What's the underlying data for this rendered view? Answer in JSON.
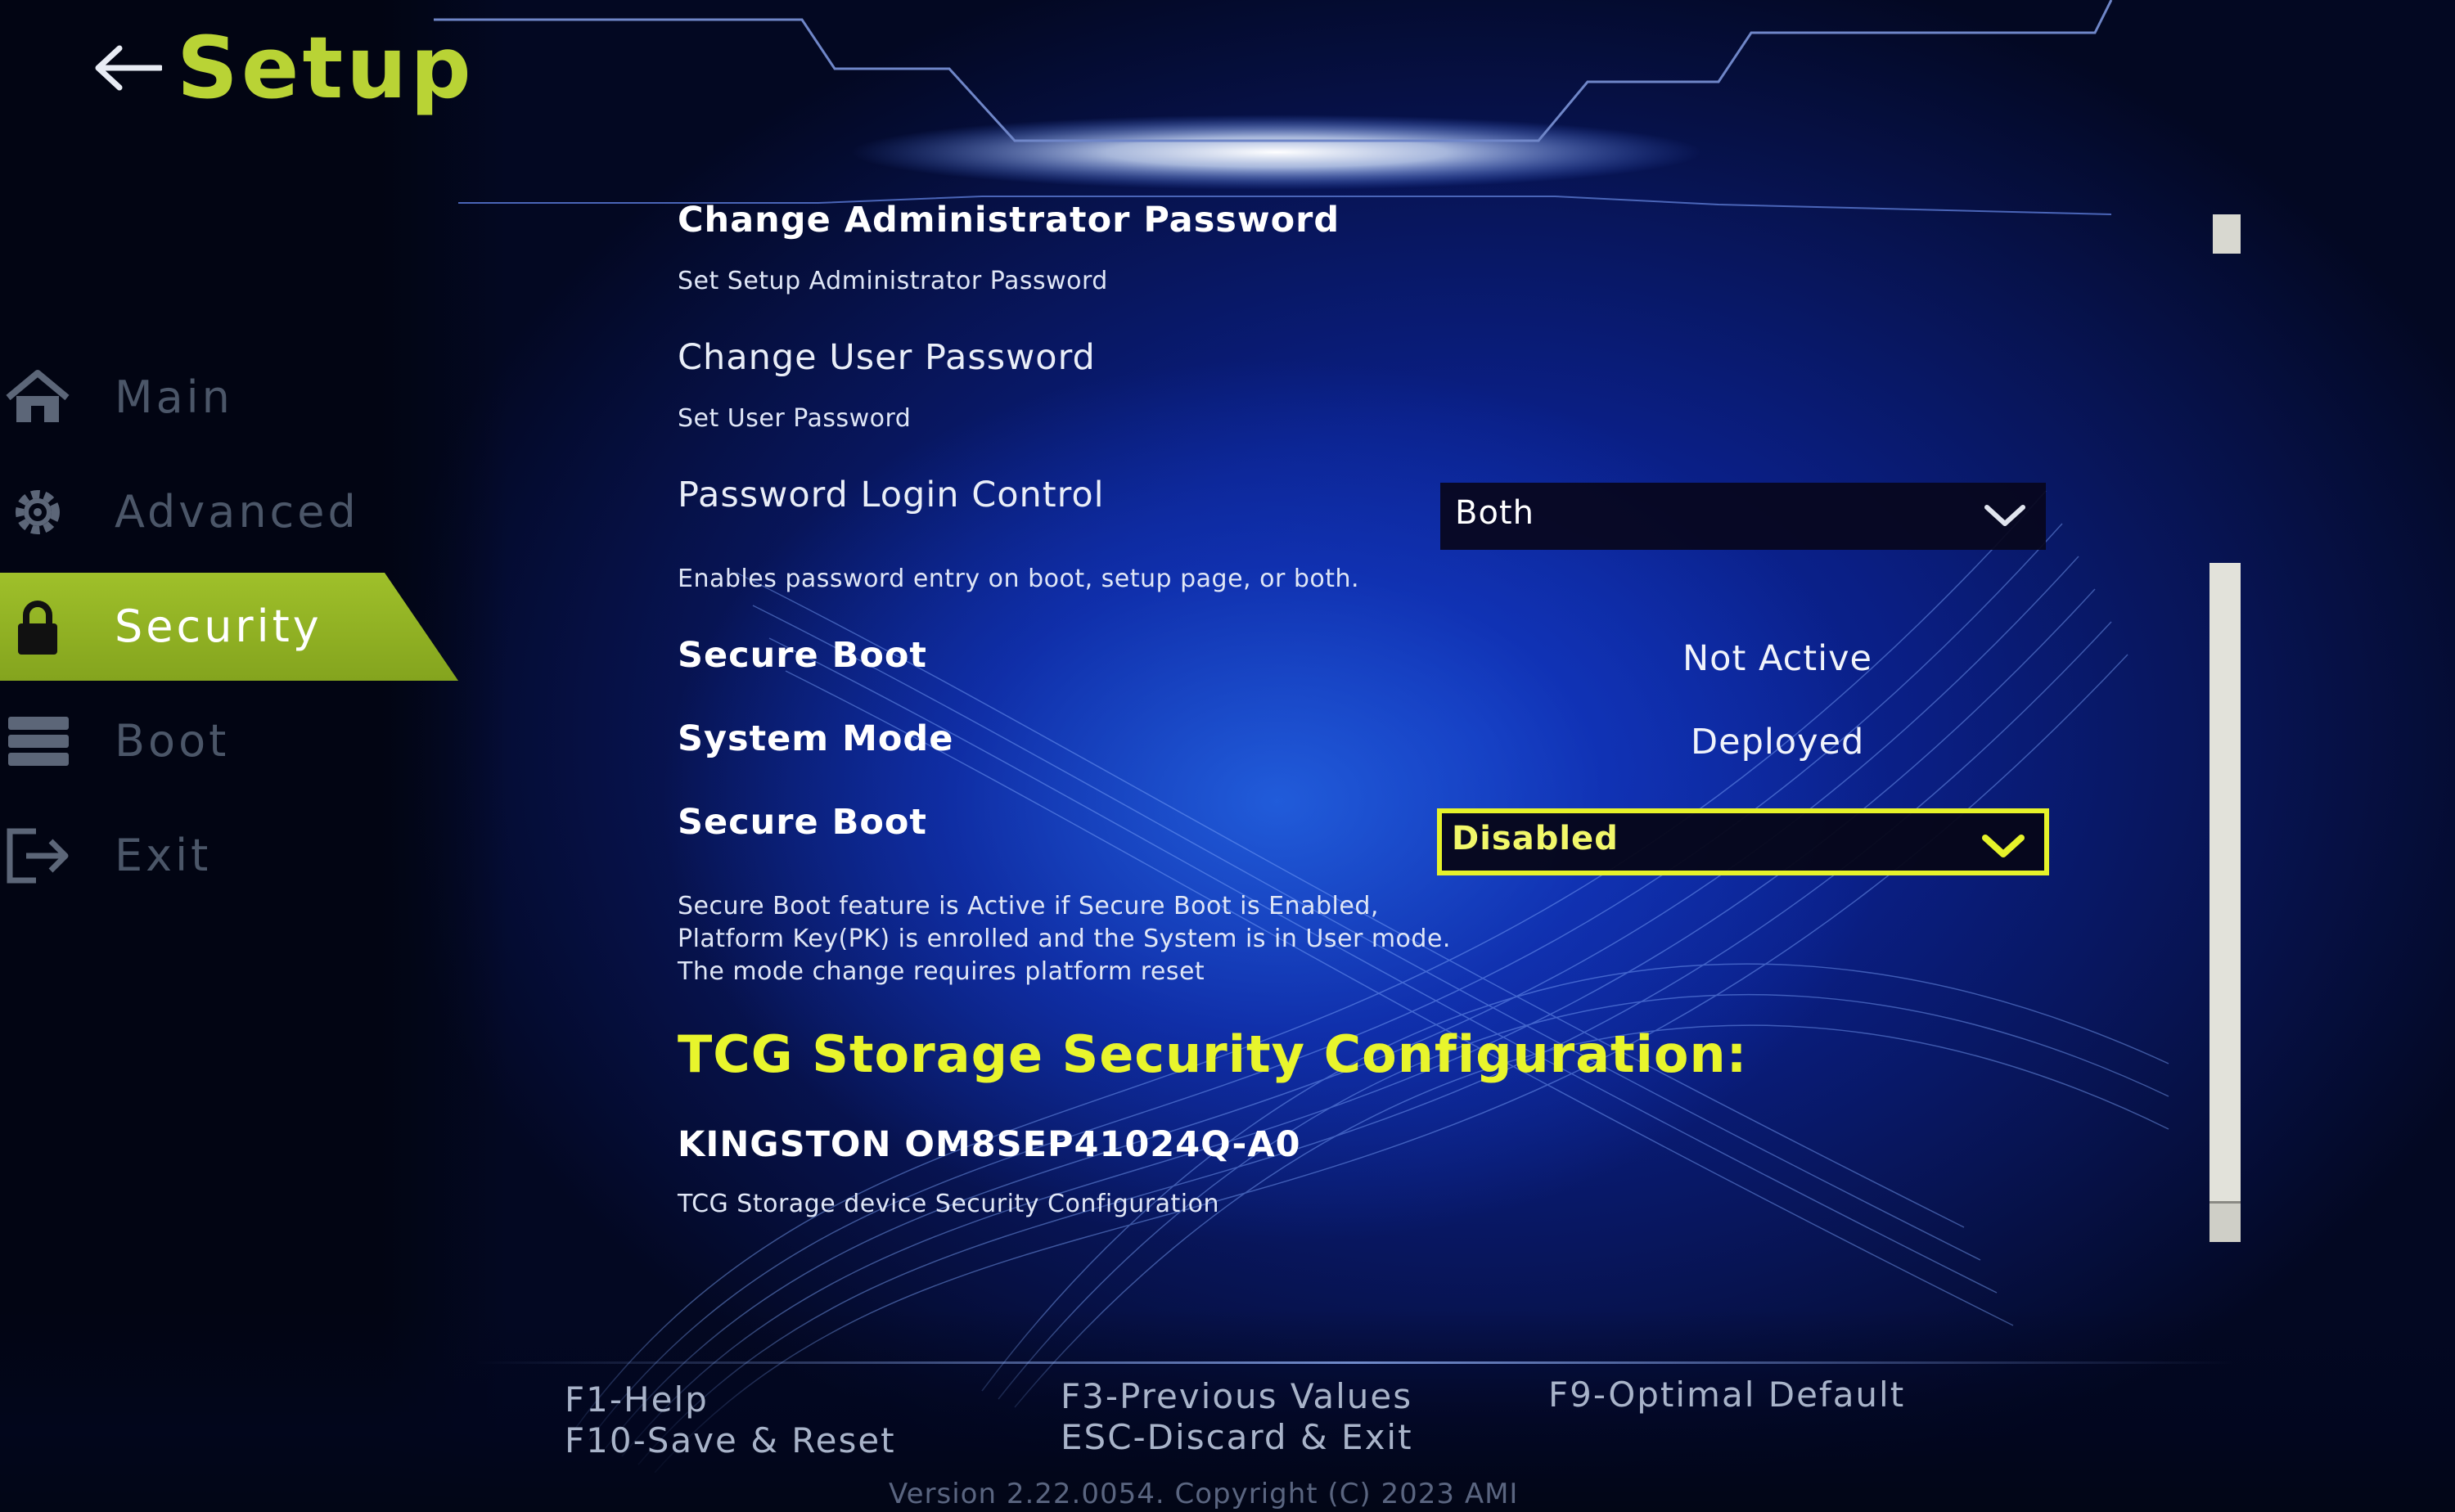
{
  "header": {
    "title": "Setup",
    "back_icon": "back-arrow-icon"
  },
  "sidebar": {
    "items": [
      {
        "label": "Main",
        "icon": "home-icon",
        "active": false
      },
      {
        "label": "Advanced",
        "icon": "gear-icon",
        "active": false
      },
      {
        "label": "Security",
        "icon": "lock-icon",
        "active": true
      },
      {
        "label": "Boot",
        "icon": "storage-icon",
        "active": false
      },
      {
        "label": "Exit",
        "icon": "exit-icon",
        "active": false
      }
    ]
  },
  "settings": {
    "admin_password": {
      "title": "Change Administrator Password",
      "desc": "Set Setup Administrator Password"
    },
    "user_password": {
      "title": "Change User Password",
      "desc": "Set User Password"
    },
    "password_login": {
      "title": "Password Login Control",
      "value": "Both",
      "desc": "Enables password entry on boot, setup page, or both."
    },
    "secure_boot_status": {
      "title": "Secure Boot",
      "value": "Not Active"
    },
    "system_mode": {
      "title": "System Mode",
      "value": "Deployed"
    },
    "secure_boot": {
      "title": "Secure Boot",
      "value": "Disabled",
      "desc_lines": [
        "Secure Boot feature is Active if Secure Boot is Enabled,",
        "Platform Key(PK) is enrolled and the System is in User mode.",
        "The mode change requires platform reset"
      ]
    },
    "tcg": {
      "heading": "TCG Storage Security Configuration:",
      "device": "KINGSTON OM8SEP41024Q-A0",
      "desc": "TCG Storage device Security Configuration"
    }
  },
  "footer": {
    "f1": "F1-Help",
    "f10": "F10-Save & Reset",
    "f3": "F3-Previous Values",
    "esc": "ESC-Discard & Exit",
    "f9": "F9-Optimal Default",
    "version": "Version 2.22.0054. Copyright (C) 2023 AMI"
  },
  "colors": {
    "accent_green": "#9fc02a",
    "title_green": "#b9d335",
    "focus_yellow": "#e6f22a",
    "background_blue": "#0d2aa8"
  }
}
